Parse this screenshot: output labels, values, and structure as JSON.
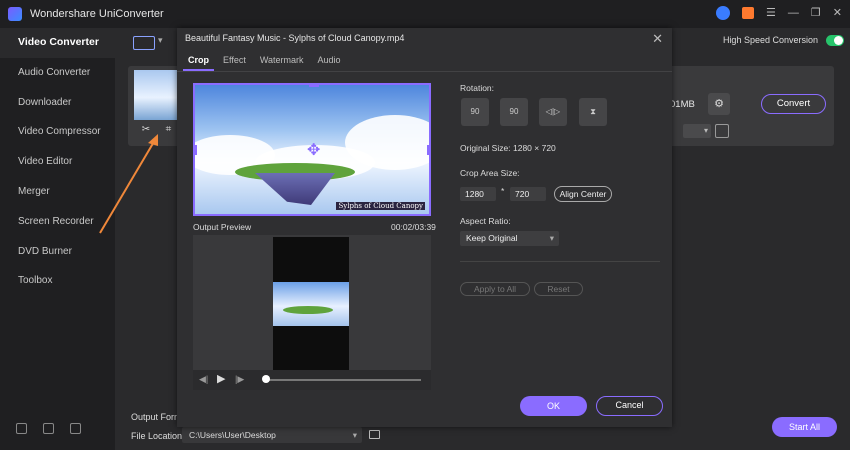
{
  "app": {
    "title": "Wondershare UniConverter"
  },
  "sidebar": {
    "items": [
      {
        "label": "Video Converter",
        "active": true
      },
      {
        "label": "Audio Converter"
      },
      {
        "label": "Downloader"
      },
      {
        "label": "Video Compressor"
      },
      {
        "label": "Video Editor"
      },
      {
        "label": "Merger"
      },
      {
        "label": "Screen Recorder"
      },
      {
        "label": "DVD Burner"
      },
      {
        "label": "Toolbox"
      }
    ]
  },
  "main": {
    "high_speed_label": "High Speed Conversion",
    "file_size": "01MB",
    "convert_label": "Convert",
    "output_format_label": "Output Forma",
    "file_location_label": "File Location:",
    "file_location_value": "C:\\Users\\User\\Desktop",
    "start_all_label": "Start All"
  },
  "dialog": {
    "title": "Beautiful Fantasy Music - Sylphs of Cloud Canopy.mp4",
    "tabs": [
      {
        "label": "Crop",
        "active": true
      },
      {
        "label": "Effect"
      },
      {
        "label": "Watermark"
      },
      {
        "label": "Audio"
      }
    ],
    "video_watermark": "Sylphs of Cloud Canopy",
    "output_preview_label": "Output Preview",
    "time": "00:02/03:39",
    "rotation_label": "Rotation:",
    "rotate_left_label": "90",
    "rotate_right_label": "90",
    "original_size_label": "Original Size:",
    "original_size_value": "1280 × 720",
    "crop_area_label": "Crop Area Size:",
    "crop_width": "1280",
    "crop_sep": "*",
    "crop_height": "720",
    "align_center_label": "Align Center",
    "aspect_ratio_label": "Aspect Ratio:",
    "aspect_ratio_value": "Keep Original",
    "apply_all_label": "Apply to All",
    "reset_label": "Reset",
    "ok_label": "OK",
    "cancel_label": "Cancel",
    "playback_progress": 0.02
  },
  "colors": {
    "accent": "#8a6cff",
    "toggle_on": "#27c46b",
    "arrow": "#f0883a"
  }
}
